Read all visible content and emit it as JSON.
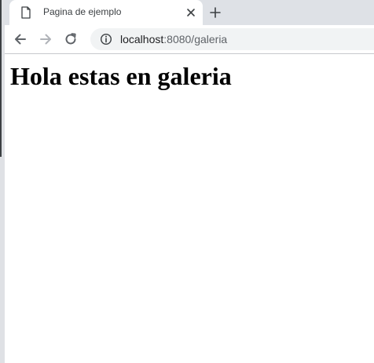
{
  "browser": {
    "tab": {
      "title": "Pagina de ejemplo",
      "favicon": "page-icon"
    },
    "new_tab_icon": "plus-icon",
    "toolbar": {
      "back_icon": "arrow-left-icon",
      "forward_icon": "arrow-right-icon",
      "reload_icon": "reload-icon"
    },
    "address_bar": {
      "security_icon": "info-icon",
      "url_host": "localhost",
      "url_rest": ":8080/galeria"
    }
  },
  "page": {
    "heading": "Hola estas en galeria"
  },
  "colors": {
    "tabstrip": "#dee1e6",
    "omnibox": "#f1f3f4",
    "icon": "#5f6368",
    "icon_disabled": "#b0b3b8"
  }
}
